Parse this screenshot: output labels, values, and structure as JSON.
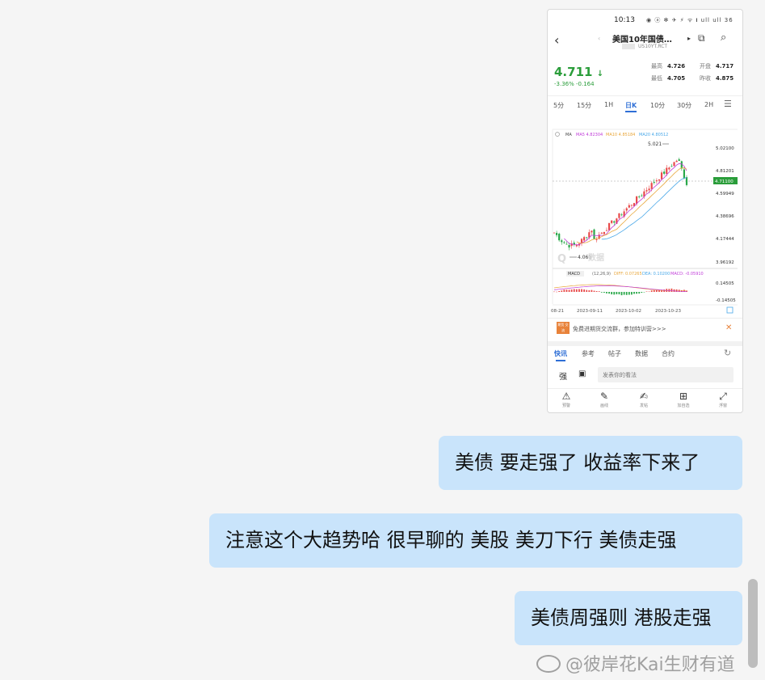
{
  "phone": {
    "status": {
      "time": "10:13",
      "icons": "◉ ⓐ ✻ ✈ ⚡ ᯤ 𝐢 ull ull 36"
    },
    "header": {
      "title": "美国10年国债…",
      "code": "US10YT.RCT"
    },
    "quote": {
      "price": "4.711",
      "change": "-3.36% -0.164",
      "high_label": "最高",
      "high": "4.726",
      "open_label": "开盘",
      "open": "4.717",
      "low_label": "最低",
      "low": "4.705",
      "prev_label": "昨收",
      "prev": "4.875"
    },
    "periods": [
      "5分",
      "15分",
      "1H",
      "日K",
      "10分",
      "30分",
      "2H"
    ],
    "active_period": "日K",
    "chart_data": {
      "type": "candlestick",
      "ma_legend": {
        "ma5": "MA5 4.82304",
        "ma10": "MA10 4.85184",
        "ma20": "MA20 4.80512"
      },
      "y_ticks": [
        "5.02100",
        "4.81201",
        "4.59949",
        "4.38696",
        "4.17444",
        "3.96192"
      ],
      "current_price_label": "4.71100",
      "max_label": "5.021",
      "min_label": "4.060",
      "macd_legend": {
        "macd": "MACD",
        "params": "(12,26,9)",
        "diff": "DIFF: 0.07265",
        "dea": "DEA: 0.10200",
        "macd_val": "MACD: -0.05910"
      },
      "macd_ticks": [
        "0.14505",
        "-0.14505"
      ],
      "x_labels": [
        "08-21",
        "2023-09-11",
        "2023-10-02",
        "2023-10-23"
      ],
      "watermark": "数据",
      "colors": {
        "up": "#e84a4a",
        "down": "#2aa84a",
        "ma5": "#c03cd8",
        "ma10": "#e8a63a",
        "ma20": "#4aa8e8"
      }
    },
    "ad": {
      "logo": "期货 交流",
      "text": "免费进期货交流群，参加特训营>>>",
      "close": "✕"
    },
    "tabs": [
      "快讯",
      "参考",
      "帖子",
      "数据",
      "合约"
    ],
    "post": {
      "icon1": "强",
      "placeholder": "发表你的看法"
    },
    "bottom": [
      {
        "icon": "⚠",
        "label": "预警"
      },
      {
        "icon": "✎",
        "label": "画线"
      },
      {
        "icon": "✍",
        "label": "发帖"
      },
      {
        "icon": "⊞",
        "label": "加自选"
      },
      {
        "icon": "⤢",
        "label": "浮窗"
      }
    ]
  },
  "messages": [
    "美债 要走强了 收益率下来了",
    "注意这个大趋势哈  很早聊的 美股 美刀下行  美债走强",
    "美债周强则 港股走强"
  ],
  "watermark": "@彼岸花Kai生财有道"
}
